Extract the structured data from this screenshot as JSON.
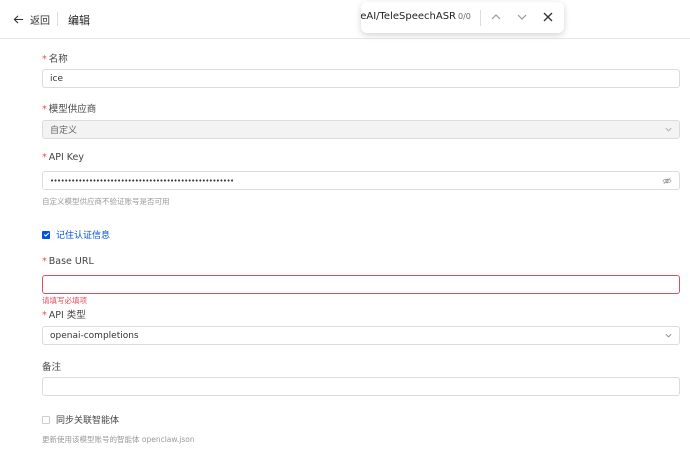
{
  "header": {
    "back_label": "返回",
    "title": "编辑"
  },
  "find_bar": {
    "query": "TeleAI/TeleSpeechASR",
    "count": "0/0"
  },
  "form": {
    "name": {
      "label": "名称",
      "required": true,
      "value": "ice"
    },
    "provider": {
      "label": "模型供应商",
      "required": true,
      "value": "自定义"
    },
    "api_key": {
      "label": "API Key",
      "required": true,
      "value": "••••••••••••••••••••••••••••••••••••••••••••••••••••",
      "hint": "自定义模型供应商不验证账号是否可用"
    },
    "remember": {
      "label": "记住认证信息",
      "checked": true
    },
    "base_url": {
      "label": "Base URL",
      "required": true,
      "value": "",
      "error": "请填写必填项"
    },
    "api_type": {
      "label": "API 类型",
      "required": true,
      "value": "openai-completions"
    },
    "remark": {
      "label": "备注",
      "value": ""
    },
    "sync_agent": {
      "label": "同步关联智能体",
      "checked": false,
      "hint": "更新使用该模型账号的智能体 openclaw.json"
    }
  },
  "colors": {
    "primary": "#0052d9",
    "error": "#e34d59",
    "border": "#dcdcdc"
  }
}
